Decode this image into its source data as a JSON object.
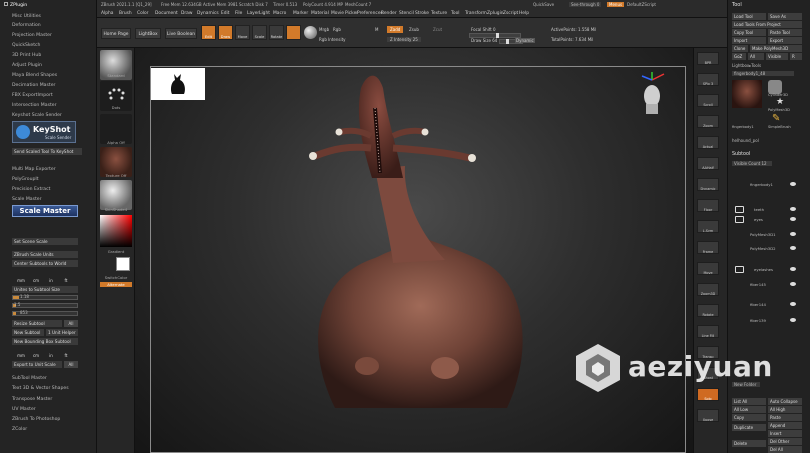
{
  "colors": {
    "accent": "#d27a2a",
    "panel": "#242424",
    "menu_bg": "#2b2b2b"
  },
  "left_panel": {
    "header": "ZPlugin",
    "items": [
      "Misc Utilities",
      "Deformation",
      "Projection Master",
      "QuickSketch",
      "3D Print Hub",
      "Adjust Plugin",
      "Maya Blend Shapes",
      "Decimation Master",
      "FBX ExportImport",
      "Intersection Master",
      "Keyshot Scale Sender"
    ],
    "keyshot": {
      "title": "KeyShot",
      "subtitle": "Scale Sender"
    },
    "send_btn": "Send Scaled Tool To KeyShot",
    "items2": [
      "Multi Map Exporter",
      "PolyGroupIt",
      "Precision Extract",
      "Scale Master"
    ],
    "scale_master_logo": "Scale Master",
    "set_scene_scale": "Set Scene Scale",
    "zbrush_scale_units": "ZBrush Scale Units",
    "center_subtools": "Center Subtools to World",
    "unit_labels": [
      "mm",
      "cm",
      "in",
      "ft"
    ],
    "units_to_subtool": "Unites to Subtool Size",
    "size_fields": [
      "1.18",
      "1.5",
      "853"
    ],
    "resize_subtool": "Resize Subtool",
    "all": "All",
    "new_subtool": "New Subtool",
    "dot_unit_helper": "1 Unit Helper",
    "new_bounding_box": "New Bounding Box Subtool",
    "unit_labels2": [
      "mm",
      "cm",
      "in",
      "ft"
    ],
    "export_to_unit_scale": "Export to Unit Scale",
    "items3": [
      "SubTool Master",
      "Text 3D & Vector Shapes",
      "Transpose Master",
      "UV Master",
      "ZBrush To Photoshop",
      "ZColor"
    ]
  },
  "title_bar": {
    "app_info": "ZBrush 2021.1.1 [Q1_29]",
    "free_mem": "Free Mem 12.634GB",
    "active_mem": "Active Mem 3981",
    "scratch_disk": "Scratch Disk 7",
    "timer": "Timer 0.513",
    "polycount": "PolyCount 4.914 MP",
    "meshcount": "MeshCount 7",
    "quicksave": "QuickSave",
    "see_through": "See-through 0",
    "menus_label": "Menus",
    "default_zscript": "DefaultZScript"
  },
  "menu_bar": [
    "Alpha",
    "Brush",
    "Color",
    "Document",
    "Draw",
    "Dynamics",
    "Edit",
    "File",
    "Layer",
    "Light",
    "Macro",
    "Marker",
    "Material",
    "Movie",
    "Picker",
    "Preferences",
    "Render",
    "Stencil",
    "Stroke",
    "Texture",
    "Tool",
    "Transform",
    "Zplugin",
    "Zscript",
    "Help"
  ],
  "shelf": {
    "home_page": "Home Page",
    "lightbox": "LightBox",
    "live_boolean": "Live Boolean",
    "tools": [
      "Edit",
      "Draw",
      "Move",
      "Scale",
      "Rotate"
    ],
    "mrgb": "Mrgb",
    "rgb": "Rgb",
    "m": "M",
    "zadd": "Zadd",
    "zsub": "Zsub",
    "zcut": "Zcut",
    "rgb_intensity": "Rgb Intensity",
    "z_intensity": "Z Intensity 25",
    "focal_shift": "Focal Shift 0",
    "draw_size": "Draw Size 64",
    "dynamic": "Dynamic",
    "active_points": "ActivePoints: 1.558 Mil",
    "total_points": "TotalPoints: 7.634 Mil"
  },
  "left_tray": {
    "labels": [
      "Standard",
      "Dots",
      "Alpha Off",
      "Texture Off",
      "SkinShade4",
      "Gradient",
      "SwitchColor",
      "Alternate"
    ]
  },
  "right_dock": {
    "buttons": [
      "BPR",
      "SPix 3",
      "Scroll",
      "Zoom",
      "Actual",
      "AAHalf",
      "Dynamic Persp",
      "Floor",
      "L.Sym",
      "Frame",
      "Move",
      "Zoom3D",
      "Rotate",
      "Line Fill PolyF",
      "Transp",
      "Ghost",
      "Solo",
      "Xpose"
    ]
  },
  "right_panel": {
    "header": "Tool",
    "buttons": [
      [
        "Load Tool",
        "Save As"
      ],
      [
        "Load Tools From Project"
      ],
      [
        "Copy Tool",
        "Paste Tool"
      ],
      [
        "Import",
        "Export"
      ],
      [
        "Clone",
        "Make PolyMesh3D"
      ],
      [
        "GoZ",
        "All",
        "Visible",
        "R"
      ]
    ],
    "lightbox_tools": "Lightbox▸Tools",
    "tool_name": "fingerbody1_48",
    "thumbs": [
      "Cylinder3D",
      "PolyMesh3D",
      "fingerbody1",
      "SimpleBrush"
    ],
    "current": "helhound_pol",
    "subtool_header": "Subtool",
    "visible_count": "Visible Count 12",
    "subtools": [
      "fingerbody1",
      "teeth",
      "eyes",
      "PolyMesh3D1",
      "PolyMesh3D2",
      "eyelashes",
      "fiber145",
      "fiber144",
      "fiber139"
    ],
    "new_folder": "New Folder",
    "bottom": [
      [
        "List All",
        "Auto Collapse"
      ],
      [
        "All Low",
        "All High"
      ],
      [
        "Copy",
        "Paste"
      ],
      [
        "Duplicate",
        "Append"
      ],
      [
        "",
        "Insert"
      ],
      [
        "Delete",
        "Del Other"
      ],
      [
        "",
        "Del All"
      ]
    ]
  },
  "watermark": {
    "text": "aeziyuan"
  }
}
